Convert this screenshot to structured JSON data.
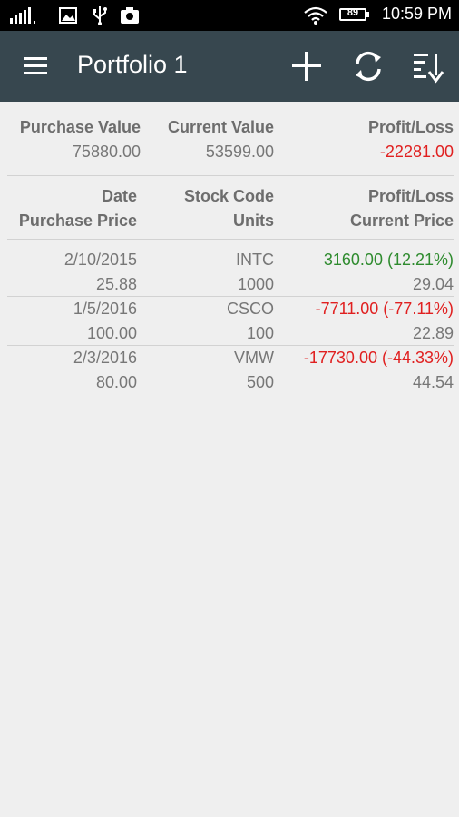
{
  "status_bar": {
    "time": "10:59 PM",
    "battery": "89",
    "icons": [
      "signal-icon",
      "image-icon",
      "usb-icon",
      "camera-icon",
      "wifi-icon",
      "battery-icon"
    ]
  },
  "app_bar": {
    "title": "Portfolio 1",
    "actions": [
      "menu-icon",
      "add-icon",
      "refresh-icon",
      "sort-icon"
    ],
    "color": "#37474f"
  },
  "summary": {
    "headers": [
      "Purchase Value",
      "Current Value",
      "Profit/Loss"
    ],
    "values": [
      "75880.00",
      "53599.00",
      "-22281.00"
    ]
  },
  "table": {
    "headers": [
      [
        "Date",
        "Stock Code",
        "Profit/Loss"
      ],
      [
        "Purchase Price",
        "Units",
        "Current Price"
      ]
    ],
    "rows": [
      {
        "date": "2/10/2015",
        "code": "INTC",
        "pl": "3160.00 (12.21%)",
        "price": "25.88",
        "units": "1000",
        "current": "29.04",
        "positive": true
      },
      {
        "date": "1/5/2016",
        "code": "CSCO",
        "pl": "-7711.00 (-77.11%)",
        "price": "100.00",
        "units": "100",
        "current": "22.89",
        "positive": false
      },
      {
        "date": "2/3/2016",
        "code": "VMW",
        "pl": "-17730.00 (-44.33%)",
        "price": "80.00",
        "units": "500",
        "current": "44.54",
        "positive": false
      }
    ]
  },
  "colors": {
    "negative": "#e02020",
    "positive": "#2e8b2e"
  }
}
